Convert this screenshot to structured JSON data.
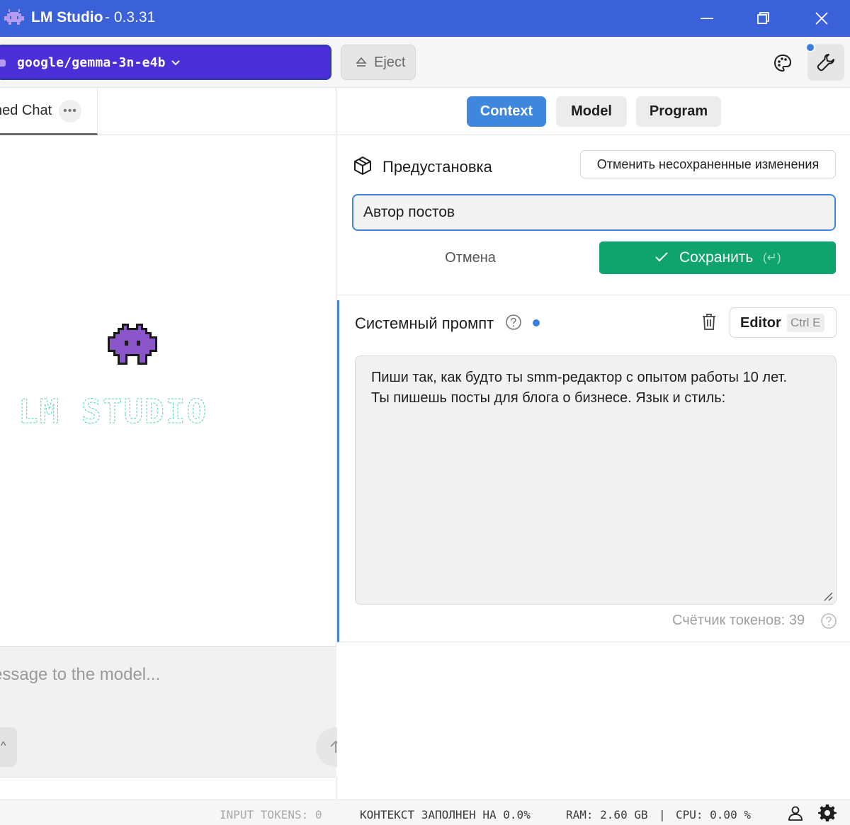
{
  "window": {
    "title": "LM Studio",
    "version": "- 0.3.31",
    "icons": {
      "app": "space-invader-icon",
      "minimize": "minimize-icon",
      "restore": "restore-icon",
      "close": "close-icon"
    }
  },
  "toolbar": {
    "model_name": "google/gemma-3n-e4b",
    "eject_label": "Eject",
    "colors": {
      "model_bg": "#4a2fd6",
      "accent": "#3f87dd"
    }
  },
  "chat": {
    "tab_label": "ned Chat",
    "tab_more": "•••",
    "message_placeholder": "essage to the model...",
    "logo_text": "LM STUDIO"
  },
  "config": {
    "tabs": [
      {
        "label": "Context",
        "active": true
      },
      {
        "label": "Model",
        "active": false
      },
      {
        "label": "Program",
        "active": false
      }
    ],
    "preset": {
      "title": "Предустановка",
      "discard_label": "Отменить несохраненные изменения",
      "name_value": "Автор постов",
      "cancel_label": "Отмена",
      "save_label": "Сохранить",
      "save_hint": "(↵)"
    },
    "system_prompt": {
      "title": "Системный промпт",
      "editor_label": "Editor",
      "editor_shortcut": "Ctrl E",
      "text": "Пиши так, как будто ты smm-редактор с опытом работы 10 лет.\nТы пишешь посты для блога о бизнесе. Язык и стиль:",
      "token_count": "Счётчик токенов: 39"
    }
  },
  "status": {
    "input_tokens": "INPUT TOKENS:  0",
    "context": "КОНТЕКСТ ЗАПОЛНЕН НА 0.0%",
    "ram": "RAM: 2.60 GB",
    "separator": "|",
    "cpu": "CPU: 0.00 %"
  }
}
